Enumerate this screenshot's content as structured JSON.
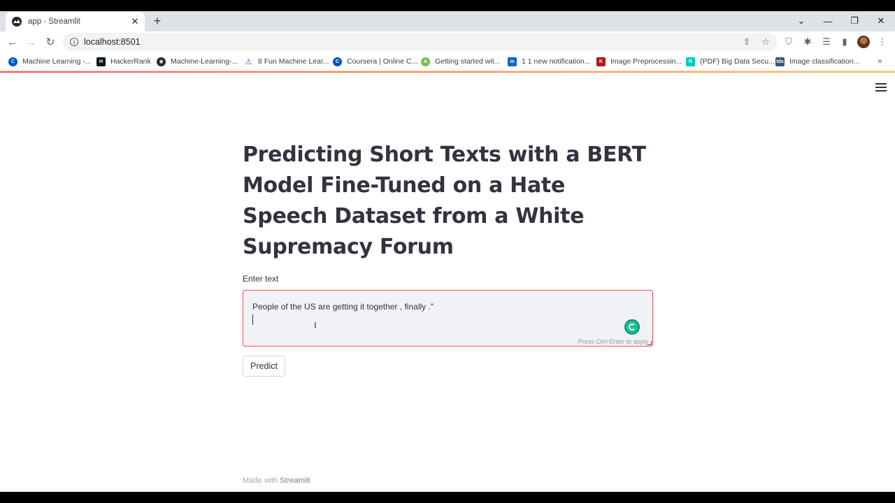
{
  "browser": {
    "tab_title": "app · Streamlit",
    "url": "localhost:8501",
    "bookmarks": [
      {
        "label": "Machine Learning -...",
        "icon": "coursera-icon",
        "color": "#0056d2"
      },
      {
        "label": "HackerRank",
        "icon": "hackerrank-icon",
        "color": "#0e141e"
      },
      {
        "label": "Machine-Learning-...",
        "icon": "github-icon",
        "color": "#24292f"
      },
      {
        "label": "8 Fun Machine Lear...",
        "icon": "flask-icon",
        "color": "#3b4ea8"
      },
      {
        "label": "Coursera | Online C...",
        "icon": "coursera-icon",
        "color": "#0056d2"
      },
      {
        "label": "Getting started wit...",
        "icon": "android-icon",
        "color": "#7bc043"
      },
      {
        "label": "1 1 new notification...",
        "icon": "linkedin-icon",
        "color": "#0a66c2"
      },
      {
        "label": "Image Preprocessin...",
        "icon": "kaggle-icon",
        "color": "#b0171f"
      },
      {
        "label": "(PDF) Big Data Secu...",
        "icon": "researchgate-icon",
        "color": "#00ccbb"
      },
      {
        "label": "Image classification...",
        "icon": "tds-icon",
        "color": "#355876"
      }
    ]
  },
  "app": {
    "title": "Predicting Short Texts with a BERT Model Fine-Tuned on a Hate Speech Dataset from a White Supremacy Forum",
    "input_label": "Enter text",
    "input_value": "People of the US are getting it together , finally .\"",
    "input_hint": "Press Ctrl+Enter to apply",
    "predict_label": "Predict",
    "footer_prefix": "Made with ",
    "footer_brand": "Streamlit",
    "accent_color": "#ff4b4b"
  }
}
